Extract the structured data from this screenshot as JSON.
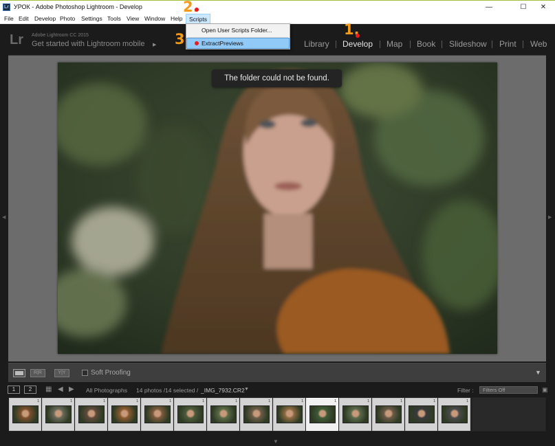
{
  "window": {
    "title": "УРОК - Adobe Photoshop Lightroom - Develop",
    "app_icon": "Lr",
    "minimize": "—",
    "maximize": "☐",
    "close": "✕"
  },
  "menubar": {
    "items": [
      "File",
      "Edit",
      "Develop",
      "Photo",
      "Settings",
      "Tools",
      "View",
      "Window",
      "Help",
      "Scripts"
    ],
    "active": "Scripts"
  },
  "scripts_menu": {
    "items": [
      "Open User Scripts Folder...",
      "ExtractPreviews"
    ],
    "selected": "ExtractPreviews"
  },
  "identity_plate": {
    "logo": "Lr",
    "version": "Adobe Lightroom CC 2015",
    "mobile": "Get started with Lightroom mobile",
    "arrow": "▶"
  },
  "modules": {
    "items": [
      "Library",
      "Develop",
      "Map",
      "Book",
      "Slideshow",
      "Print",
      "Web"
    ],
    "active": "Develop"
  },
  "annotations": [
    "1.",
    "2.",
    "3"
  ],
  "toast": "The folder could not be found.",
  "toolbar": {
    "view_compare_1": "R|R",
    "view_compare_2": "Y|Y",
    "soft_proofing": "Soft Proofing",
    "caret": "▼"
  },
  "filmstrip_header": {
    "screen1": "1",
    "screen2": "2",
    "source": "All Photographs",
    "count": "14 photos /14 selected /",
    "filename": "_IMG_7932.CR2",
    "filename_caret": "▼",
    "filter_label": "Filter :",
    "filter_value": "Filters Off"
  },
  "filmstrip": {
    "badge": "1",
    "frames": 14,
    "current_index": 9
  },
  "colors": {
    "accent_annotation": "#f39a1b",
    "annotation_dot": "#e81c1c",
    "menu_highlight": "#91c9f7"
  }
}
